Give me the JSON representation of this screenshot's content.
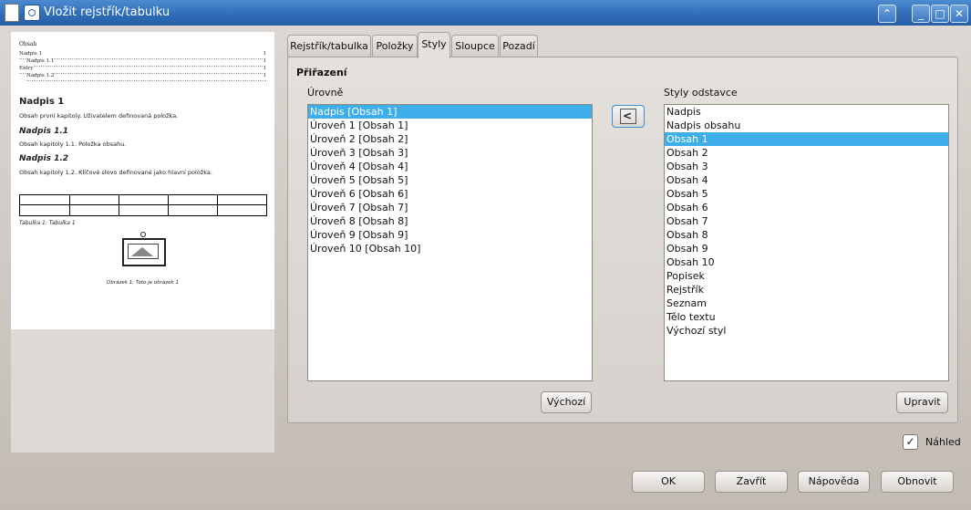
{
  "window": {
    "title": "Vložit rejstřík/tabulku"
  },
  "preview": {
    "toc_title": "Obsah",
    "toc": [
      {
        "text": "Nadpis 1",
        "page": "1"
      },
      {
        "text": "Nadpis 1.1",
        "page": "1"
      },
      {
        "text": "Entry",
        "page": "1"
      },
      {
        "text": "Nadpis 1.2",
        "page": "1"
      }
    ],
    "h1": "Nadpis 1",
    "p1": "Obsah první kapitoly. Uživatelem definovaná položka.",
    "h2a": "Nadpis 1.1",
    "p2": "Obsah kapitoly 1.1. Položka obsahu.",
    "h2b": "Nadpis 1.2",
    "p3": "Obsah kapitoly 1.2. Klíčové slovo definované jako hlavní položka.",
    "table_caption": "Tabulka 1: Tabulka 1",
    "figure_caption": "Obrázek 1: Toto je obrázek 1"
  },
  "tabs": [
    "Rejstřík/tabulka",
    "Položky",
    "Styly",
    "Sloupce",
    "Pozadí"
  ],
  "active_tab": "Styly",
  "assignment": {
    "title": "Přiřazení",
    "levels_label": "Úrovně",
    "levels": [
      "Nadpis [Obsah 1]",
      "Úroveň 1 [Obsah 1]",
      "Úroveň 2 [Obsah 2]",
      "Úroveň 3 [Obsah 3]",
      "Úroveň 4 [Obsah 4]",
      "Úroveň 5 [Obsah 5]",
      "Úroveň 6 [Obsah 6]",
      "Úroveň 7 [Obsah 7]",
      "Úroveň 8 [Obsah 8]",
      "Úroveň 9 [Obsah 9]",
      "Úroveň 10 [Obsah 10]"
    ],
    "selected_level": "Nadpis [Obsah 1]",
    "styles_label": "Styly odstavce",
    "styles": [
      "Nadpis",
      "Nadpis obsahu",
      "Obsah 1",
      "Obsah 2",
      "Obsah 3",
      "Obsah 4",
      "Obsah 5",
      "Obsah 6",
      "Obsah 7",
      "Obsah 8",
      "Obsah 9",
      "Obsah 10",
      "Popisek",
      "Rejstřík",
      "Seznam",
      "Tělo textu",
      "Výchozí styl"
    ],
    "selected_style": "Obsah 1",
    "default_button": "Výchozí",
    "edit_button": "Upravit"
  },
  "preview_checkbox": {
    "label": "Náhled",
    "checked": true
  },
  "buttons": {
    "ok": "OK",
    "close": "Zavřít",
    "help": "Nápověda",
    "reset": "Obnovit"
  },
  "icons": {
    "doc": "document-icon",
    "app": "app-icon",
    "up": "keep-above-icon",
    "min": "minimize-icon",
    "max": "maximize-icon",
    "close": "close-icon",
    "assign": "assign-left-icon",
    "check": "checkmark-icon"
  }
}
